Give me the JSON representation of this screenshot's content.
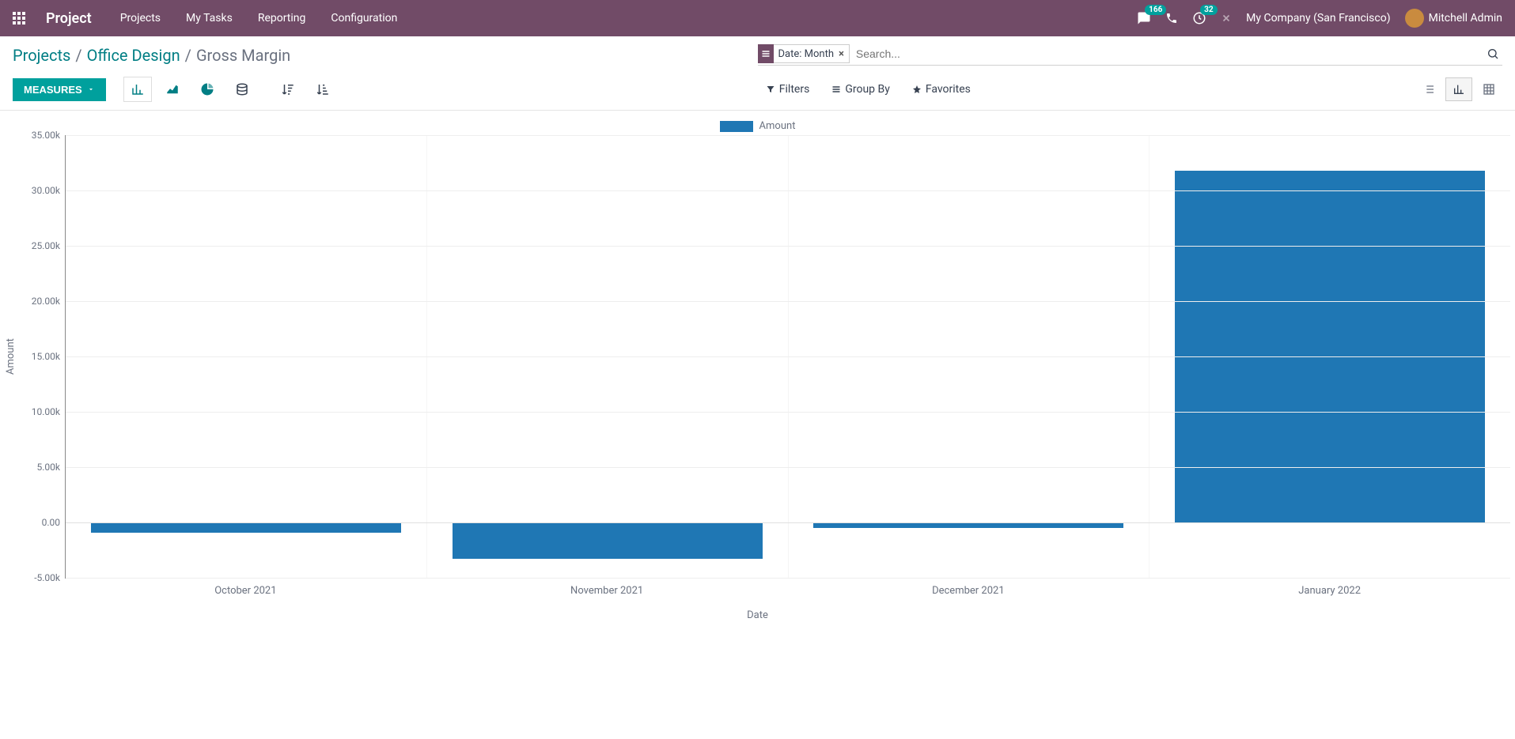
{
  "topbar": {
    "brand": "Project",
    "nav": [
      "Projects",
      "My Tasks",
      "Reporting",
      "Configuration"
    ],
    "messages_badge": "166",
    "activities_badge": "32",
    "company": "My Company (San Francisco)",
    "user": "Mitchell Admin"
  },
  "breadcrumb": {
    "items": [
      "Projects",
      "Office Design",
      "Gross Margin"
    ]
  },
  "search": {
    "facet_label": "Date: Month",
    "placeholder": "Search..."
  },
  "toolbar": {
    "measures_label": "MEASURES",
    "filters_label": "Filters",
    "groupby_label": "Group By",
    "favorites_label": "Favorites"
  },
  "chart_legend": "Amount",
  "chart_xlabel": "Date",
  "chart_ylabel": "Amount",
  "chart_data": {
    "type": "bar",
    "title": "",
    "xlabel": "Date",
    "ylabel": "Amount",
    "ylim": [
      -5000,
      35000
    ],
    "yticks": [
      -5000,
      0,
      5000,
      10000,
      15000,
      20000,
      25000,
      30000,
      35000
    ],
    "ytick_labels": [
      "-5.00k",
      "0.00",
      "5.00k",
      "10.00k",
      "15.00k",
      "20.00k",
      "25.00k",
      "30.00k",
      "35.00k"
    ],
    "categories": [
      "October 2021",
      "November 2021",
      "December 2021",
      "January 2022"
    ],
    "series": [
      {
        "name": "Amount",
        "color": "#1f77b4",
        "values": [
          -900,
          -3300,
          -500,
          31800
        ]
      }
    ]
  }
}
